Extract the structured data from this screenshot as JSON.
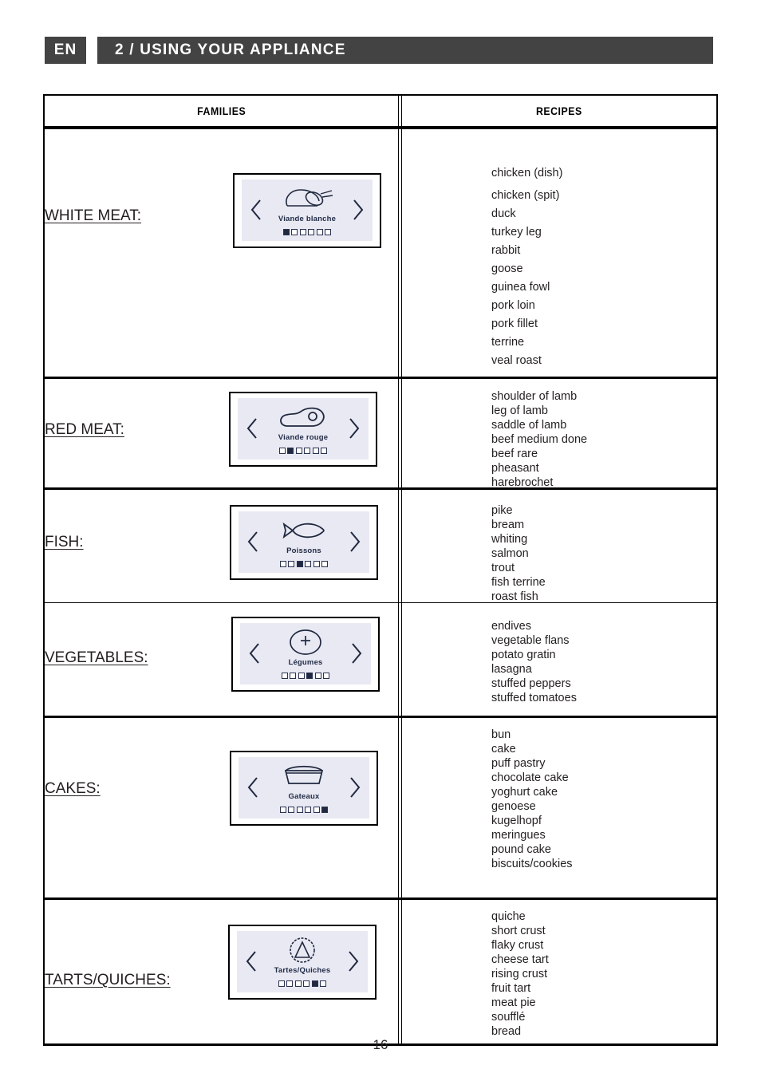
{
  "header": {
    "language": "EN",
    "title": "2 / USING YOUR APPLIANCE"
  },
  "table": {
    "columns": {
      "families": "FAMILIES",
      "recipes": "RECIPES"
    },
    "rows": [
      {
        "family_label": "WHITE MEAT:",
        "display": {
          "name": "Viande blanche",
          "icon": "poultry-icon",
          "steps": 6,
          "active_step": 1,
          "prev_label": "previous",
          "next_label": "next"
        },
        "recipes": [
          "chicken (dish)",
          "chicken (spit)",
          "duck",
          "turkey leg",
          "rabbit",
          "goose",
          "guinea fowl",
          "pork loin",
          "pork fillet",
          "terrine",
          "veal roast"
        ]
      },
      {
        "family_label": "RED MEAT:",
        "display": {
          "name": "Viande rouge",
          "icon": "meat-cut-icon",
          "steps": 6,
          "active_step": 2,
          "prev_label": "previous",
          "next_label": "next"
        },
        "recipes": [
          "shoulder of lamb",
          "leg of lamb",
          "saddle of lamb",
          "beef medium done",
          "beef rare",
          "pheasant",
          "harebrochet"
        ]
      },
      {
        "family_label": " FISH:",
        "display": {
          "name": "Poissons",
          "icon": "fish-icon",
          "steps": 6,
          "active_step": 3,
          "prev_label": "previous",
          "next_label": "next"
        },
        "recipes": [
          "pike",
          "bream",
          "whiting",
          "salmon",
          "trout",
          "fish terrine",
          "roast fish"
        ]
      },
      {
        "family_label": "VEGETABLES:",
        "display": {
          "name": "Légumes",
          "icon": "vegetable-dish-icon",
          "steps": 6,
          "active_step": 4,
          "prev_label": "previous",
          "next_label": "next"
        },
        "recipes": [
          "endives",
          "vegetable flans",
          "potato gratin",
          "lasagna",
          "stuffed peppers",
          "stuffed tomatoes"
        ]
      },
      {
        "family_label": "CAKES:",
        "display": {
          "name": "Gateaux",
          "icon": "cake-mold-icon",
          "steps": 6,
          "active_step": 6,
          "prev_label": "previous",
          "next_label": "next"
        },
        "recipes": [
          "bun",
          "cake",
          "puff pastry",
          "chocolate cake",
          "yoghurt cake",
          "genoese",
          "kugelhopf",
          "meringues",
          "pound cake",
          "biscuits/cookies"
        ]
      },
      {
        "family_label": "TARTS/QUICHES:",
        "display": {
          "name": "Tartes/Quiches",
          "icon": "tart-icon",
          "steps": 6,
          "active_step": 5,
          "prev_label": "previous",
          "next_label": "next"
        },
        "recipes": [
          "quiche",
          "short crust",
          "flaky crust",
          "cheese tart",
          "rising crust",
          "fruit tart",
          "meat pie",
          "soufflé",
          "bread"
        ]
      }
    ]
  },
  "footer": {
    "page_number": "16"
  },
  "colors": {
    "header_bar": "#434343",
    "screen_background": "#e9e9f3",
    "screen_ink": "#20293f",
    "text": "#231f20"
  }
}
